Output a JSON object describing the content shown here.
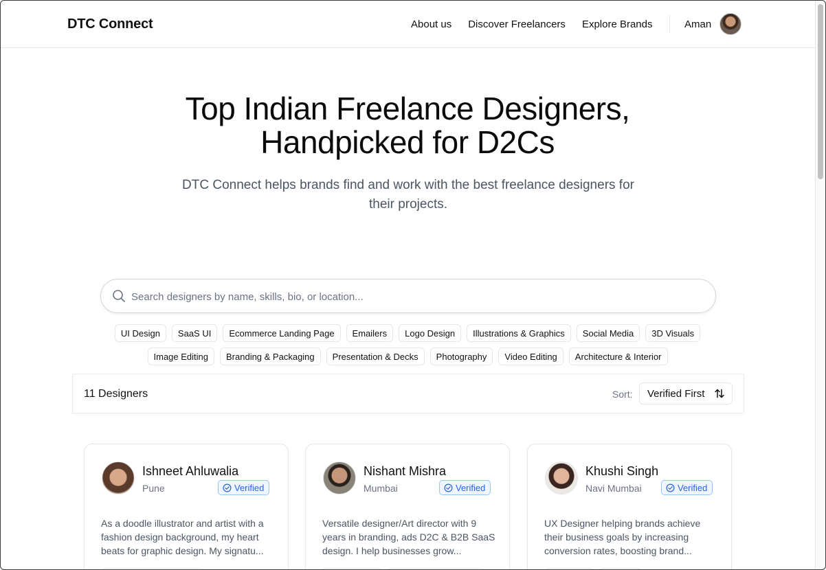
{
  "header": {
    "brand": "DTC Connect",
    "nav": [
      "About us",
      "Discover Freelancers",
      "Explore Brands"
    ],
    "user_name": "Aman"
  },
  "hero": {
    "title_line1": "Top Indian Freelance Designers,",
    "title_line2": "Handpicked for D2Cs",
    "subtitle": "DTC Connect helps brands find and work with the best freelance designers for their projects."
  },
  "search": {
    "placeholder": "Search designers by name, skills, bio, or location...",
    "value": ""
  },
  "tags_row1": [
    "UI Design",
    "SaaS UI",
    "Ecommerce Landing Page",
    "Emailers",
    "Logo Design",
    "Illustrations & Graphics",
    "Social Media",
    "3D Visuals"
  ],
  "tags_row2": [
    "Image Editing",
    "Branding & Packaging",
    "Presentation & Decks",
    "Photography",
    "Video Editing",
    "Architecture & Interior"
  ],
  "results": {
    "count_label": "11 Designers",
    "sort_label": "Sort:",
    "sort_value": "Verified First"
  },
  "designers": [
    {
      "name": "Ishneet Ahluwalia",
      "location": "Pune",
      "badge": "Verified",
      "bio": "As a doodle illustrator and artist with a fashion design background, my heart beats for graphic design. My signatu..."
    },
    {
      "name": "Nishant Mishra",
      "location": "Mumbai",
      "badge": "Verified",
      "bio": "Versatile designer/Art director with 9 years in branding, ads D2C & B2B SaaS design. I help businesses grow..."
    },
    {
      "name": "Khushi Singh",
      "location": "Navi Mumbai",
      "badge": "Verified",
      "bio": "UX Designer helping brands achieve their business goals by increasing conversion rates, boosting brand..."
    }
  ],
  "colors": {
    "verified_blue": "#2563eb",
    "verified_bg": "#eff6ff",
    "muted_text": "#6b7280",
    "border": "#e5e7eb"
  }
}
